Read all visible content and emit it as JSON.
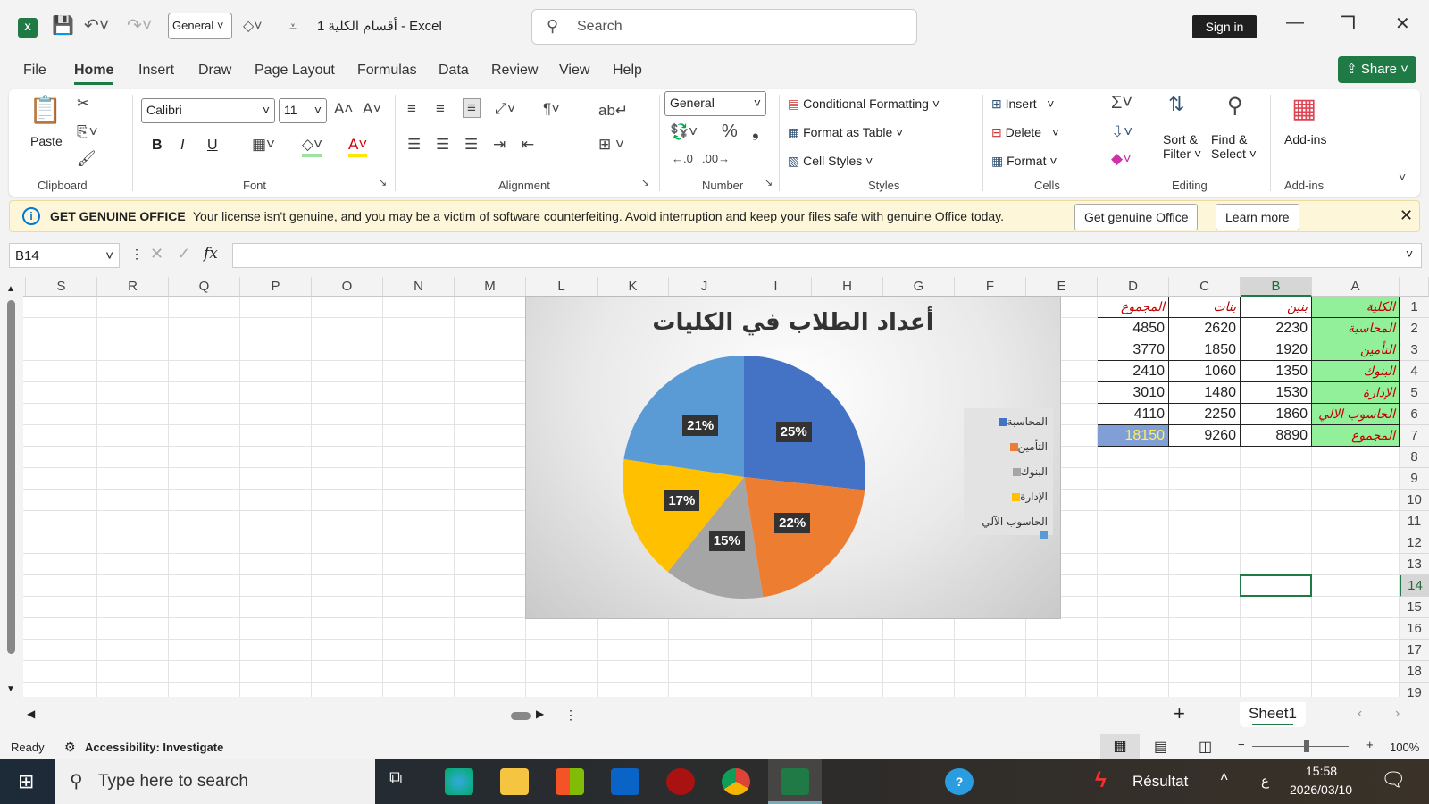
{
  "titlebar": {
    "format_value": "General",
    "doc_title": "أقسام الكلية 1  -  Excel",
    "search_placeholder": "Search",
    "signin": "Sign in"
  },
  "menu": [
    "File",
    "Home",
    "Insert",
    "Draw",
    "Page Layout",
    "Formulas",
    "Data",
    "Review",
    "View",
    "Help"
  ],
  "share": "Share",
  "ribbon": {
    "clipboard": {
      "label": "Clipboard",
      "paste": "Paste"
    },
    "font": {
      "label": "Font",
      "name": "Calibri",
      "size": "11",
      "bold": "B",
      "italic": "I",
      "underline": "U"
    },
    "alignment": {
      "label": "Alignment"
    },
    "number": {
      "label": "Number",
      "format": "General"
    },
    "styles": {
      "label": "Styles",
      "conditional": "Conditional Formatting",
      "format_table": "Format as Table",
      "cell_styles": "Cell Styles"
    },
    "cells": {
      "label": "Cells",
      "insert": "Insert",
      "delete": "Delete",
      "format": "Format"
    },
    "editing": {
      "label": "Editing",
      "sort": "Sort &",
      "filter": "Filter",
      "find": "Find &",
      "select": "Select"
    },
    "addins": {
      "label": "Add-ins",
      "addins": "Add-ins"
    }
  },
  "license": {
    "heading": "GET GENUINE OFFICE",
    "message": "Your license isn't genuine, and you may be a victim of software counterfeiting. Avoid interruption and keep your files safe with genuine Office today.",
    "get_button": "Get genuine Office",
    "learn_button": "Learn more"
  },
  "formula_bar": {
    "name_box": "B14",
    "fx": "fx",
    "value": ""
  },
  "sheet": {
    "columns": [
      "S",
      "R",
      "Q",
      "P",
      "O",
      "N",
      "M",
      "L",
      "K",
      "J",
      "I",
      "H",
      "G",
      "F",
      "E",
      "D",
      "C",
      "B",
      "A"
    ],
    "rows": [
      "1",
      "2",
      "3",
      "4",
      "5",
      "6",
      "7",
      "8",
      "9",
      "10",
      "11",
      "12",
      "13",
      "14",
      "15",
      "16",
      "17",
      "18",
      "19"
    ],
    "selected_column": "B",
    "selected_row": "14",
    "table": [
      [
        "الكلية",
        "بنين",
        "بنات",
        "المجموع"
      ],
      [
        "المحاسبة",
        "2230",
        "2620",
        "4850"
      ],
      [
        "التأمين",
        "1920",
        "1850",
        "3770"
      ],
      [
        "البنوك",
        "1350",
        "1060",
        "2410"
      ],
      [
        "الإدارة",
        "1530",
        "1480",
        "3010"
      ],
      [
        "الحاسوب الالي",
        "1860",
        "2250",
        "4110"
      ],
      [
        "المجموع",
        "8890",
        "9260",
        "18150"
      ]
    ]
  },
  "chart_data": {
    "type": "pie",
    "title": "أعداد الطلاب في الكليات",
    "categories": [
      "المحاسبة",
      "التأمين",
      "البنوك",
      "الإدارة",
      "الحاسوب الآلي"
    ],
    "values": [
      4850,
      3770,
      2410,
      3010,
      4110
    ],
    "labels": [
      "25%",
      "22%",
      "15%",
      "17%",
      "21%"
    ],
    "colors": [
      "#4472c4",
      "#ed7d31",
      "#a5a5a5",
      "#ffc000",
      "#5b9bd5"
    ],
    "legend": "right"
  },
  "sheet_tabs": {
    "active": "Sheet1",
    "add": "+"
  },
  "status": {
    "ready": "Ready",
    "accessibility": "Accessibility: Investigate",
    "zoom": "100%"
  },
  "taskbar": {
    "search_placeholder": "Type here to search",
    "weather": "Résultat",
    "lang": "ع",
    "time": "15:58",
    "date": "2026/03/10"
  }
}
